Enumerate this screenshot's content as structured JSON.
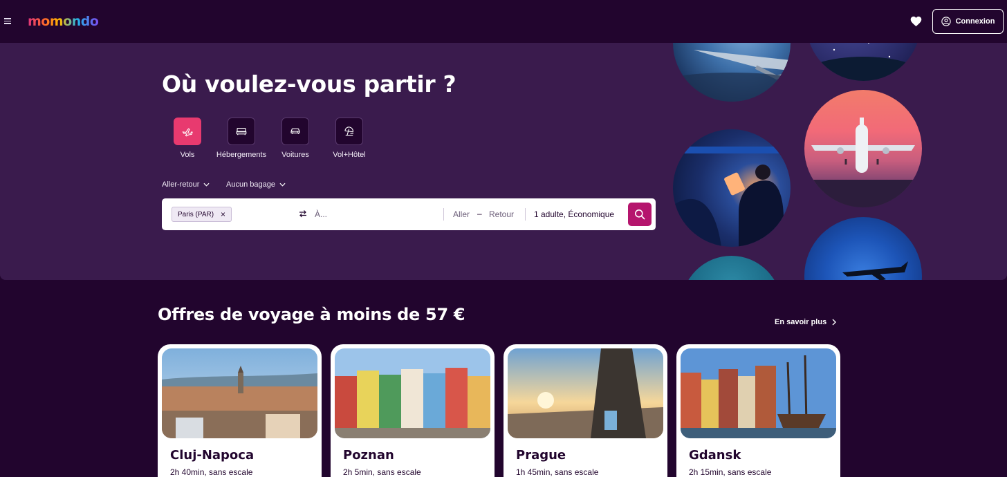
{
  "header": {
    "logo": "momondo",
    "login_label": "Connexion"
  },
  "hero": {
    "title": "Où voulez-vous partir ?",
    "verticals": [
      {
        "label": "Vols",
        "icon": "plane-icon",
        "active": true
      },
      {
        "label": "Hébergements",
        "icon": "bed-icon",
        "active": false
      },
      {
        "label": "Voitures",
        "icon": "car-icon",
        "active": false
      },
      {
        "label": "Vol+Hôtel",
        "icon": "beach-umbrella-icon",
        "active": false
      }
    ],
    "trip_type": "Aller-retour",
    "baggage": "Aucun bagage"
  },
  "search": {
    "origin_chip": "Paris (PAR)",
    "destination_placeholder": "À...",
    "depart_label": "Aller",
    "dash": "–",
    "return_label": "Retour",
    "passengers": "1 adulte, Économique"
  },
  "deals": {
    "title": "Offres de voyage à moins de 57 €",
    "more_label": "En savoir plus",
    "cards": [
      {
        "city": "Cluj-Napoca",
        "trip": "2h 40min, sans escale"
      },
      {
        "city": "Poznan",
        "trip": "2h 5min, sans escale"
      },
      {
        "city": "Prague",
        "trip": "1h 45min, sans escale"
      },
      {
        "city": "Gdansk",
        "trip": "2h 15min, sans escale"
      }
    ]
  },
  "colors": {
    "page_bg": "#22052e",
    "hero_bg": "#3a1b4d",
    "accent_pink": "#e83a6f",
    "search_button": "#b5156d"
  }
}
